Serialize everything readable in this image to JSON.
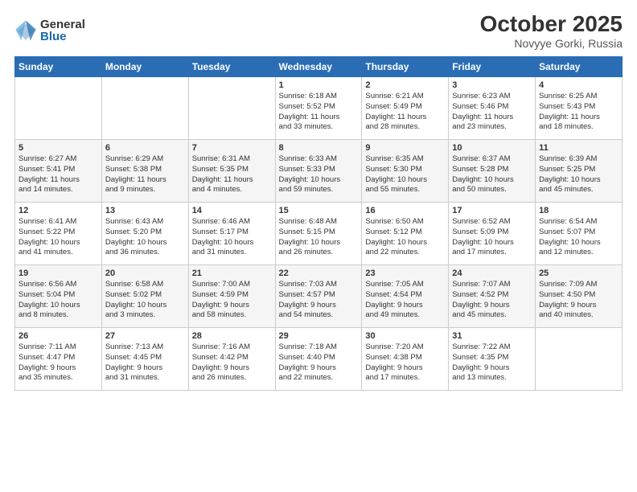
{
  "header": {
    "logo_general": "General",
    "logo_blue": "Blue",
    "month": "October 2025",
    "location": "Novyye Gorki, Russia"
  },
  "days_of_week": [
    "Sunday",
    "Monday",
    "Tuesday",
    "Wednesday",
    "Thursday",
    "Friday",
    "Saturday"
  ],
  "weeks": [
    [
      {
        "day": "",
        "info": ""
      },
      {
        "day": "",
        "info": ""
      },
      {
        "day": "",
        "info": ""
      },
      {
        "day": "1",
        "info": "Sunrise: 6:18 AM\nSunset: 5:52 PM\nDaylight: 11 hours\nand 33 minutes."
      },
      {
        "day": "2",
        "info": "Sunrise: 6:21 AM\nSunset: 5:49 PM\nDaylight: 11 hours\nand 28 minutes."
      },
      {
        "day": "3",
        "info": "Sunrise: 6:23 AM\nSunset: 5:46 PM\nDaylight: 11 hours\nand 23 minutes."
      },
      {
        "day": "4",
        "info": "Sunrise: 6:25 AM\nSunset: 5:43 PM\nDaylight: 11 hours\nand 18 minutes."
      }
    ],
    [
      {
        "day": "5",
        "info": "Sunrise: 6:27 AM\nSunset: 5:41 PM\nDaylight: 11 hours\nand 14 minutes."
      },
      {
        "day": "6",
        "info": "Sunrise: 6:29 AM\nSunset: 5:38 PM\nDaylight: 11 hours\nand 9 minutes."
      },
      {
        "day": "7",
        "info": "Sunrise: 6:31 AM\nSunset: 5:35 PM\nDaylight: 11 hours\nand 4 minutes."
      },
      {
        "day": "8",
        "info": "Sunrise: 6:33 AM\nSunset: 5:33 PM\nDaylight: 10 hours\nand 59 minutes."
      },
      {
        "day": "9",
        "info": "Sunrise: 6:35 AM\nSunset: 5:30 PM\nDaylight: 10 hours\nand 55 minutes."
      },
      {
        "day": "10",
        "info": "Sunrise: 6:37 AM\nSunset: 5:28 PM\nDaylight: 10 hours\nand 50 minutes."
      },
      {
        "day": "11",
        "info": "Sunrise: 6:39 AM\nSunset: 5:25 PM\nDaylight: 10 hours\nand 45 minutes."
      }
    ],
    [
      {
        "day": "12",
        "info": "Sunrise: 6:41 AM\nSunset: 5:22 PM\nDaylight: 10 hours\nand 41 minutes."
      },
      {
        "day": "13",
        "info": "Sunrise: 6:43 AM\nSunset: 5:20 PM\nDaylight: 10 hours\nand 36 minutes."
      },
      {
        "day": "14",
        "info": "Sunrise: 6:46 AM\nSunset: 5:17 PM\nDaylight: 10 hours\nand 31 minutes."
      },
      {
        "day": "15",
        "info": "Sunrise: 6:48 AM\nSunset: 5:15 PM\nDaylight: 10 hours\nand 26 minutes."
      },
      {
        "day": "16",
        "info": "Sunrise: 6:50 AM\nSunset: 5:12 PM\nDaylight: 10 hours\nand 22 minutes."
      },
      {
        "day": "17",
        "info": "Sunrise: 6:52 AM\nSunset: 5:09 PM\nDaylight: 10 hours\nand 17 minutes."
      },
      {
        "day": "18",
        "info": "Sunrise: 6:54 AM\nSunset: 5:07 PM\nDaylight: 10 hours\nand 12 minutes."
      }
    ],
    [
      {
        "day": "19",
        "info": "Sunrise: 6:56 AM\nSunset: 5:04 PM\nDaylight: 10 hours\nand 8 minutes."
      },
      {
        "day": "20",
        "info": "Sunrise: 6:58 AM\nSunset: 5:02 PM\nDaylight: 10 hours\nand 3 minutes."
      },
      {
        "day": "21",
        "info": "Sunrise: 7:00 AM\nSunset: 4:59 PM\nDaylight: 9 hours\nand 58 minutes."
      },
      {
        "day": "22",
        "info": "Sunrise: 7:03 AM\nSunset: 4:57 PM\nDaylight: 9 hours\nand 54 minutes."
      },
      {
        "day": "23",
        "info": "Sunrise: 7:05 AM\nSunset: 4:54 PM\nDaylight: 9 hours\nand 49 minutes."
      },
      {
        "day": "24",
        "info": "Sunrise: 7:07 AM\nSunset: 4:52 PM\nDaylight: 9 hours\nand 45 minutes."
      },
      {
        "day": "25",
        "info": "Sunrise: 7:09 AM\nSunset: 4:50 PM\nDaylight: 9 hours\nand 40 minutes."
      }
    ],
    [
      {
        "day": "26",
        "info": "Sunrise: 7:11 AM\nSunset: 4:47 PM\nDaylight: 9 hours\nand 35 minutes."
      },
      {
        "day": "27",
        "info": "Sunrise: 7:13 AM\nSunset: 4:45 PM\nDaylight: 9 hours\nand 31 minutes."
      },
      {
        "day": "28",
        "info": "Sunrise: 7:16 AM\nSunset: 4:42 PM\nDaylight: 9 hours\nand 26 minutes."
      },
      {
        "day": "29",
        "info": "Sunrise: 7:18 AM\nSunset: 4:40 PM\nDaylight: 9 hours\nand 22 minutes."
      },
      {
        "day": "30",
        "info": "Sunrise: 7:20 AM\nSunset: 4:38 PM\nDaylight: 9 hours\nand 17 minutes."
      },
      {
        "day": "31",
        "info": "Sunrise: 7:22 AM\nSunset: 4:35 PM\nDaylight: 9 hours\nand 13 minutes."
      },
      {
        "day": "",
        "info": ""
      }
    ]
  ]
}
